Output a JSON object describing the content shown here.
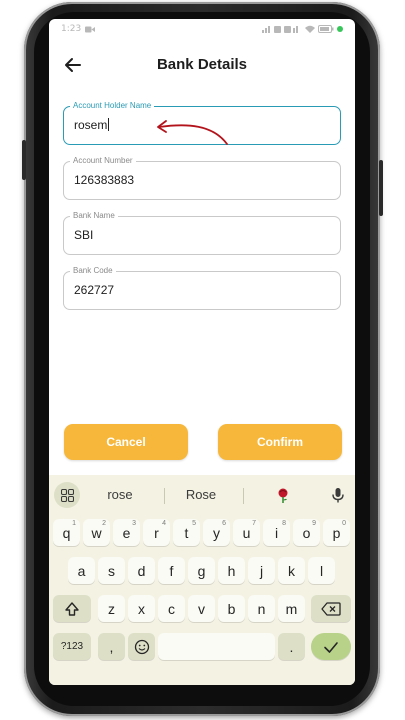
{
  "status_bar": {
    "time": "1:23",
    "icons": [
      "video-icon",
      "signal-icon",
      "wifi-icon",
      "battery-icon"
    ]
  },
  "app_bar": {
    "title": "Bank Details"
  },
  "form": {
    "fields": [
      {
        "label": "Account Holder Name",
        "value": "rosem",
        "focused": true
      },
      {
        "label": "Account Number",
        "value": "126383883"
      },
      {
        "label": "Bank Name",
        "value": "SBI"
      },
      {
        "label": "Bank Code",
        "value": "262727"
      }
    ]
  },
  "actions": {
    "cancel_label": "Cancel",
    "confirm_label": "Confirm"
  },
  "keyboard": {
    "suggestions": [
      "rose",
      "Rose"
    ],
    "row1": [
      "q",
      "w",
      "e",
      "r",
      "t",
      "y",
      "u",
      "i",
      "o",
      "p"
    ],
    "row1_hints": [
      "1",
      "2",
      "3",
      "4",
      "5",
      "6",
      "7",
      "8",
      "9",
      "0"
    ],
    "row2": [
      "a",
      "s",
      "d",
      "f",
      "g",
      "h",
      "j",
      "k",
      "l"
    ],
    "row3": [
      "z",
      "x",
      "c",
      "v",
      "b",
      "n",
      "m"
    ],
    "symbols_label": "?123",
    "comma": ",",
    "period": "."
  },
  "colors": {
    "accent": "#f6b73a",
    "focus": "#2a9bb5",
    "keyboard_bg": "#f3f2e3",
    "enter_key": "#b8d28a"
  }
}
